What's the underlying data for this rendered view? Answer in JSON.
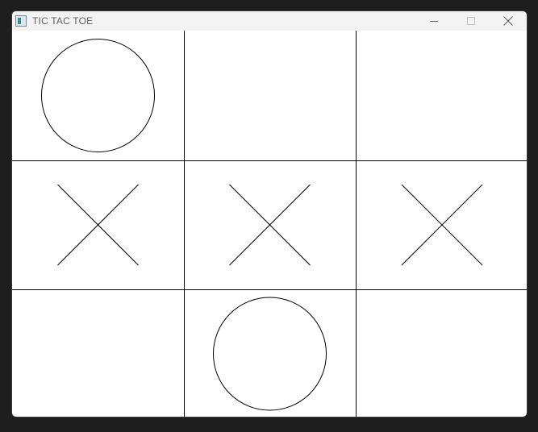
{
  "window": {
    "title": "TIC TAC TOE",
    "app_icon": "app-window-icon",
    "controls": [
      "minimize-icon",
      "maximize-icon",
      "close-icon"
    ]
  },
  "board": {
    "rows": 3,
    "cols": 3,
    "cells": [
      "O",
      "",
      "",
      "X",
      "X",
      "X",
      "",
      "O",
      ""
    ],
    "line_color": "#000000"
  }
}
